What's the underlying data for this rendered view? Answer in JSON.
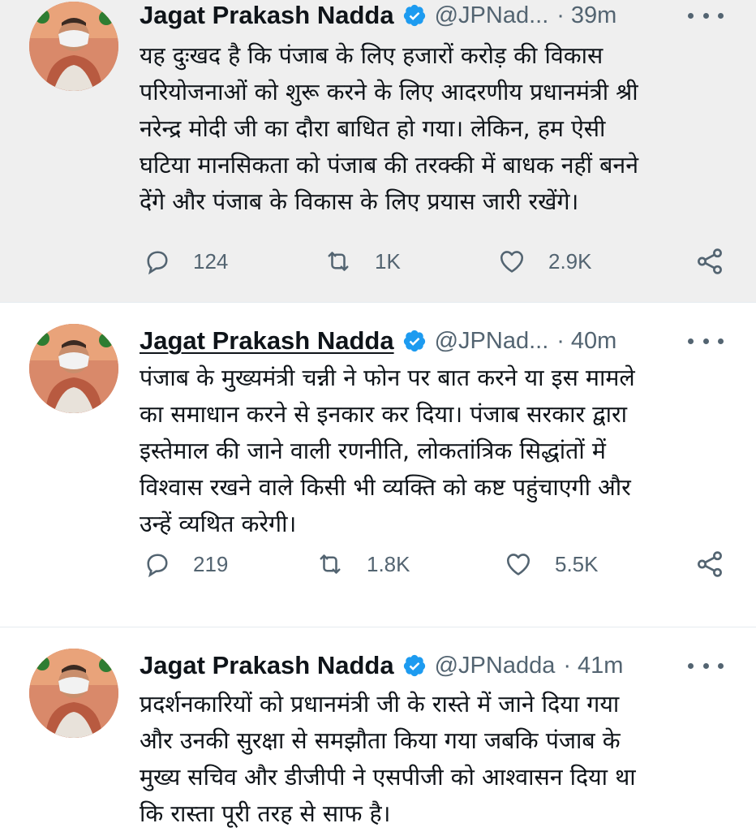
{
  "tweets": [
    {
      "author": {
        "name": "Jagat Prakash Nadda",
        "handle": "@JPNad...",
        "verified": true
      },
      "separator": "·",
      "time": "39m",
      "lines": [
        "यह दुःखद है कि पंजाब के लिए हजारों करोड़ की विकास",
        "परियोजनाओं को शुरू करने के लिए आदरणीय प्रधानमंत्री श्री",
        "नरेन्द्र मोदी जी का दौरा बाधित हो गया। लेकिन, हम ऐसी",
        "घटिया मानसिकता को पंजाब की तरक्की में बाधक नहीं बनने",
        "देंगे और पंजाब के विकास के लिए प्रयास जारी रखेंगे।"
      ],
      "stats": {
        "replies": "124",
        "retweets": "1K",
        "likes": "2.9K"
      }
    },
    {
      "author": {
        "name": "Jagat Prakash Nadda",
        "handle": "@JPNad...",
        "verified": true
      },
      "separator": "·",
      "time": "40m",
      "lines": [
        "पंजाब के मुख्यमंत्री चन्नी ने फोन पर बात करने या इस मामले",
        "का समाधान करने से इनकार कर दिया। पंजाब सरकार द्वारा",
        "इस्तेमाल की जाने वाली रणनीति, लोकतांत्रिक सिद्धांतों में",
        "विश्वास रखने वाले किसी भी व्यक्ति को कष्ट पहुंचाएगी और",
        "उन्हें व्यथित करेगी।"
      ],
      "stats": {
        "replies": "219",
        "retweets": "1.8K",
        "likes": "5.5K"
      }
    },
    {
      "author": {
        "name": "Jagat Prakash Nadda",
        "handle": "@JPNadda",
        "verified": true
      },
      "separator": "·",
      "time": "41m",
      "lines": [
        "प्रदर्शनकारियों को प्रधानमंत्री जी के रास्ते में जाने दिया गया",
        "और उनकी सुरक्षा से समझौता किया गया जबकि पंजाब के",
        "मुख्य सचिव और डीजीपी ने एसपीजी को आश्वासन दिया था",
        "कि रास्ता पूरी तरह से साफ है।"
      ]
    }
  ],
  "icons": {
    "reply": "reply-icon",
    "retweet": "retweet-icon",
    "like": "heart-icon",
    "share": "share-icon",
    "verified": "verified-badge-icon",
    "more": "more-options-icon"
  },
  "colors": {
    "verified_blue": "#1d9bf0",
    "secondary_text": "#536471",
    "highlight_bg": "#efefef"
  }
}
